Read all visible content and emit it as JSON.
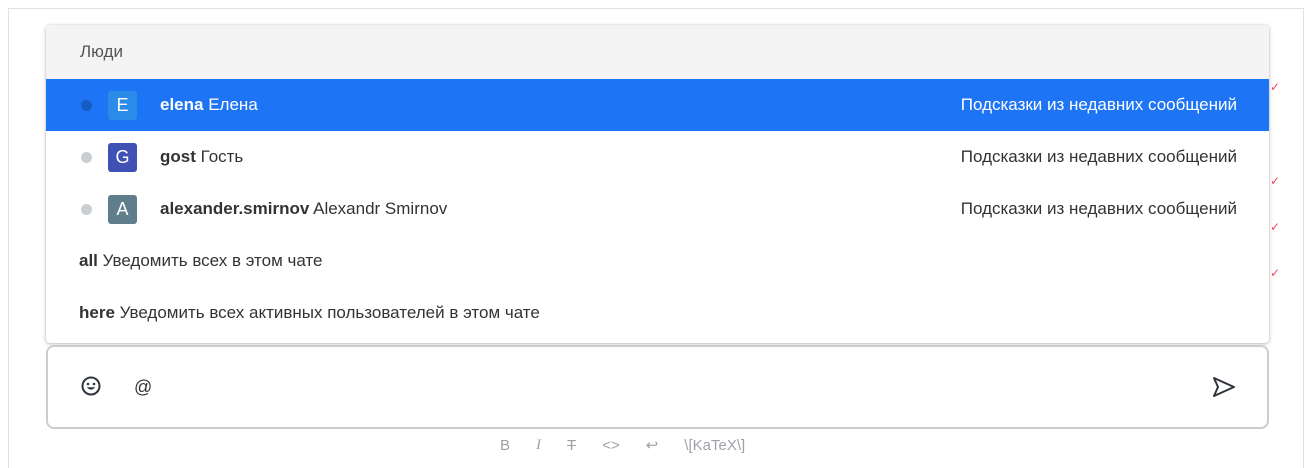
{
  "popup": {
    "header": "Люди",
    "users": [
      {
        "status": "online",
        "avatar_letter": "E",
        "avatar_color": "#2b8be8",
        "username": "elena",
        "name": "Елена",
        "hint": "Подсказки из недавних сообщений",
        "active": true
      },
      {
        "status": "offline",
        "avatar_letter": "G",
        "avatar_color": "#3f51b5",
        "username": "gost",
        "name": "Гость",
        "hint": "Подсказки из недавних сообщений",
        "active": false
      },
      {
        "status": "offline",
        "avatar_letter": "A",
        "avatar_color": "#607d8b",
        "username": "alexander.smirnov",
        "name": "Alexandr Smirnov",
        "hint": "Подсказки из недавних сообщений",
        "active": false
      }
    ],
    "mentions": [
      {
        "key": "all",
        "description": "Уведомить всех в этом чате"
      },
      {
        "key": "here",
        "description": "Уведомить всех активных пользователей в этом чате"
      }
    ]
  },
  "composer": {
    "value": "@",
    "emoji_icon": "emoji-icon",
    "send_icon": "send-icon"
  },
  "format_bar": {
    "bold": "B",
    "italic": "I",
    "strike": "T",
    "code": "<>",
    "multiline": "↩",
    "katex": "\\[KaTeX\\]"
  },
  "colors": {
    "active_row": "#1d74f5",
    "composer_border": "#cbced1",
    "format_text": "#9ea2a8",
    "read_check": "#f5455c"
  }
}
